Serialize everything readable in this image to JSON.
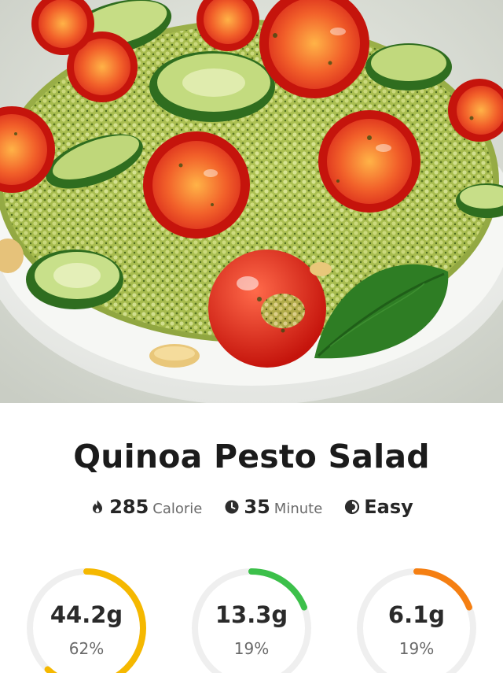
{
  "recipe": {
    "title": "Quinoa Pesto Salad",
    "photo_alt": "Quinoa pesto salad with cherry tomatoes, cucumber and basil in a white bowl"
  },
  "stats": {
    "calories": {
      "value": "285",
      "unit": "Calorie",
      "icon": "flame-icon"
    },
    "time": {
      "value": "35",
      "unit": "Minute",
      "icon": "clock-icon"
    },
    "difficulty": {
      "value": "Easy",
      "icon": "half-circle-icon"
    }
  },
  "macros": [
    {
      "amount": "44.2g",
      "percent_label": "62%",
      "fraction": 0.62,
      "color": "#f5b800"
    },
    {
      "amount": "13.3g",
      "percent_label": "19%",
      "fraction": 0.19,
      "color": "#3cc04a"
    },
    {
      "amount": "6.1g",
      "percent_label": "19%",
      "fraction": 0.19,
      "color": "#f57f12"
    }
  ],
  "colors": {
    "track": "#efefef"
  }
}
